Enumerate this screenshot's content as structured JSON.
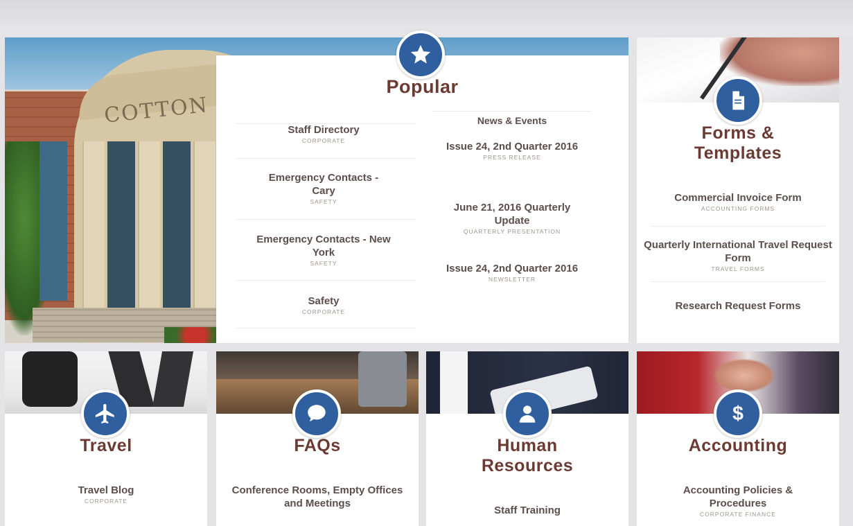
{
  "header": {
    "title_fragment": ""
  },
  "popular": {
    "title": "Popular",
    "icon": "star-icon",
    "left_links": [
      {
        "label": "Staff Directory",
        "sub": "CORPORATE"
      },
      {
        "label": "Emergency Contacts - Cary",
        "sub": "SAFETY"
      },
      {
        "label": "Emergency Contacts - New York",
        "sub": "SAFETY"
      },
      {
        "label": "Safety",
        "sub": "CORPORATE"
      }
    ],
    "news_heading": "News & Events",
    "news_links": [
      {
        "label": "Issue 24, 2nd Quarter 2016",
        "sub": "PRESS RELEASE"
      },
      {
        "label": "June 21, 2016 Quarterly Update",
        "sub": "QUARTERLY PRESENTATION"
      },
      {
        "label": "Issue 24, 2nd Quarter 2016",
        "sub": "NEWSLETTER"
      }
    ]
  },
  "hero": {
    "building_lettering": "COTTON IN"
  },
  "forms": {
    "title": "Forms & Templates",
    "icon": "document-icon",
    "links": [
      {
        "label": "Commercial Invoice Form",
        "sub": "ACCOUNTING FORMS"
      },
      {
        "label": "Quarterly International Travel Request Form",
        "sub": "TRAVEL FORMS"
      },
      {
        "label": "Research Request Forms",
        "sub": ""
      }
    ]
  },
  "cards": {
    "travel": {
      "title": "Travel",
      "icon": "airplane-icon",
      "link": "Travel Blog",
      "sub": "CORPORATE"
    },
    "faqs": {
      "title": "FAQs",
      "icon": "speech-bubble-icon",
      "link": "Conference Rooms, Empty Offices and Meetings",
      "sub": ""
    },
    "hr": {
      "title": "Human Resources",
      "icon": "person-icon",
      "link": "Staff Training",
      "sub": ""
    },
    "accounting": {
      "title": "Accounting",
      "icon": "dollar-icon",
      "link": "Accounting Policies & Procedures",
      "sub": "CORPORATE FINANCE"
    }
  },
  "colors": {
    "accent": "#2f5f9f",
    "title": "#6b3a33",
    "text": "#5b4e4b",
    "subtext": "#9d9491",
    "background": "#e4e4e6"
  }
}
